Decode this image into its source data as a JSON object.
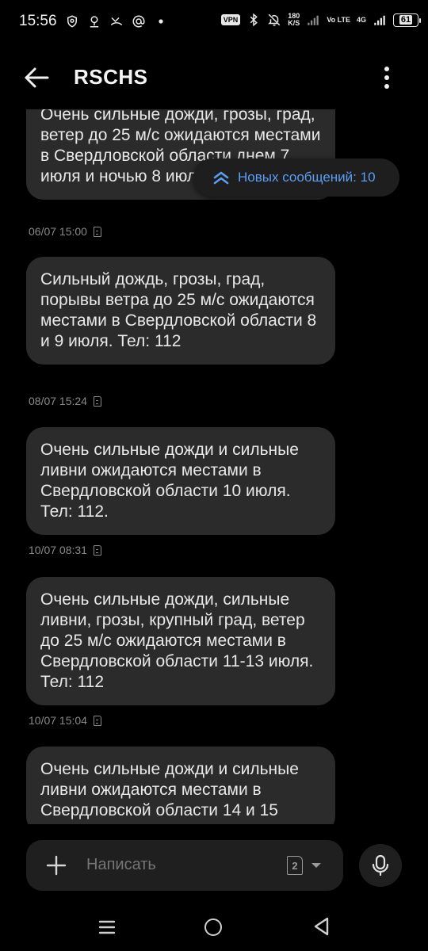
{
  "status_bar": {
    "time": "15:56",
    "vpn": "VPN",
    "net_speed_value": "180",
    "net_speed_unit": "K/S",
    "volte": "Vo LTE",
    "network": "4G",
    "battery": "61",
    "left_icons": [
      "shield-icon",
      "location-icon",
      "missed-call-icon",
      "at-icon",
      "dot-icon"
    ],
    "right_icons": [
      "bluetooth-icon",
      "mute-icon",
      "signal-icon"
    ]
  },
  "app_bar": {
    "title": "RSCHS",
    "back_icon": "back-arrow-icon",
    "more_icon": "more-vert-icon"
  },
  "new_messages": {
    "label": "Новых сообщений: 10",
    "icon": "double-chevron-up-icon",
    "accent": "#5b9ef5"
  },
  "messages": [
    {
      "text": "Очень сильные дожди, грозы, град, ветер до 25 м/с ожидаются местами в Свердловской области днем 7 июля и ночью 8 июля. Тел: 112.",
      "timestamp": "06/07 15:00"
    },
    {
      "text": "Сильный дождь, грозы, град, порывы ветра до 25 м/с ожидаются местами в Свердловской области 8 и 9 июля. Тел: 112",
      "timestamp": "08/07 15:24"
    },
    {
      "text": "Очень сильные дожди и сильные ливни ожидаются местами в Свердловской области 10 июля. Тел: 112.",
      "timestamp": "10/07 08:31"
    },
    {
      "text": "Очень сильные дожди, сильные ливни, грозы, крупный град, ветер до 25 м/с ожидаются местами в Свердловской области 11-13 июля. Тел: 112",
      "timestamp": "10/07 15:04"
    },
    {
      "text": "Очень сильные дожди и сильные ливни ожидаются местами в Свердловской области 14 и 15",
      "timestamp": ""
    }
  ],
  "compose": {
    "placeholder": "Написать",
    "sim": "2",
    "add_icon": "plus-icon",
    "sim_icon": "sim-card-icon",
    "dropdown_icon": "caret-down-icon",
    "mic_icon": "microphone-icon"
  },
  "nav_bar": {
    "icons": [
      "recents-icon",
      "home-icon",
      "back-triangle-icon"
    ]
  },
  "colors": {
    "background": "#000000",
    "bubble": "#2b2b2b",
    "accent": "#5b9ef5"
  }
}
